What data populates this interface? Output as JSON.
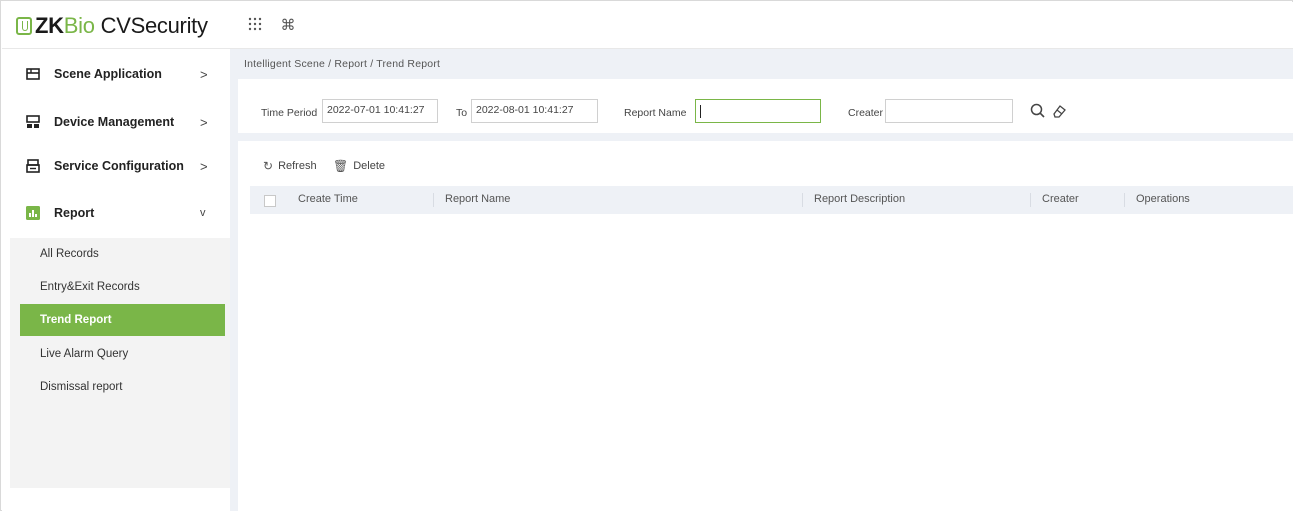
{
  "app": {
    "logo_zk": "ZK",
    "logo_bio": "Bio",
    "logo_product": "CVSecurity",
    "top_icons": [
      "grid-icon",
      "command-icon"
    ]
  },
  "sidebar": {
    "items": [
      {
        "label": "Scene Application",
        "icon": "scene-icon",
        "arrow": ">"
      },
      {
        "label": "Device Management",
        "icon": "device-icon",
        "arrow": ">"
      },
      {
        "label": "Service Configuration",
        "icon": "service-icon",
        "arrow": ">"
      },
      {
        "label": "Report",
        "icon": "report-icon",
        "arrow": "v"
      }
    ],
    "submenu": [
      {
        "label": "All Records",
        "active": false
      },
      {
        "label": "Entry&Exit Records",
        "active": false
      },
      {
        "label": "Trend Report",
        "active": true
      },
      {
        "label": "Live Alarm Query",
        "active": false
      },
      {
        "label": "Dismissal report",
        "active": false
      }
    ]
  },
  "breadcrumb": "Intelligent Scene / Report / Trend Report",
  "filters": {
    "time_period_label": "Time Period",
    "time_start": "2022-07-01 10:41:27",
    "to_label": "To",
    "time_end": "2022-08-01 10:41:27",
    "report_name_label": "Report Name",
    "report_name_value": "",
    "creater_label": "Creater",
    "creater_value": ""
  },
  "toolbar": {
    "refresh_label": "Refresh",
    "delete_label": "Delete"
  },
  "table": {
    "columns": [
      "Create Time",
      "Report Name",
      "Report Description",
      "Creater",
      "Operations"
    ],
    "rows": []
  },
  "colors": {
    "accent": "#7ab648",
    "header_bg": "#eef1f6"
  }
}
